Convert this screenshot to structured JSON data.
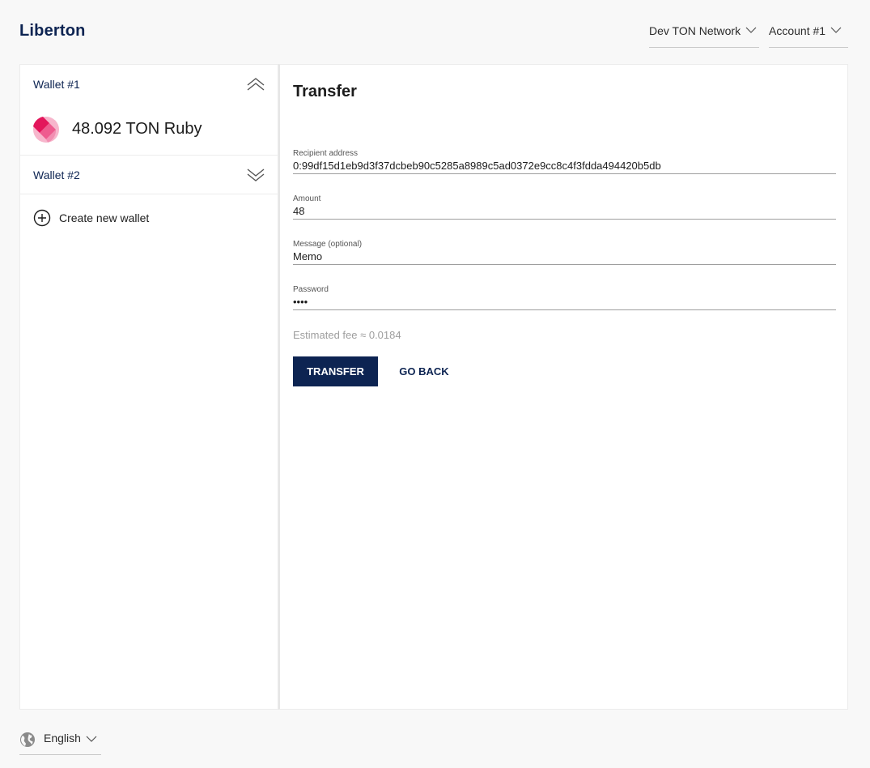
{
  "app": {
    "title": "Liberton"
  },
  "header": {
    "network": "Dev TON Network",
    "account": "Account #1"
  },
  "sidebar": {
    "wallets": [
      {
        "name": "Wallet #1",
        "expanded": true,
        "balance": "48.092 TON Ruby"
      },
      {
        "name": "Wallet #2",
        "expanded": false
      }
    ],
    "create_label": "Create new wallet"
  },
  "transfer": {
    "title": "Transfer",
    "recipient": {
      "label": "Recipient address",
      "value": "0:99df15d1eb9d3f37dcbeb90c5285a8989c5ad0372e9cc8c4f3fdda494420b5db"
    },
    "amount": {
      "label": "Amount",
      "value": "48"
    },
    "message": {
      "label": "Message (optional)",
      "value": "Memo"
    },
    "password": {
      "label": "Password",
      "value": "1234"
    },
    "fee": "Estimated fee ≈ 0.0184",
    "submit_label": "TRANSFER",
    "back_label": "GO BACK"
  },
  "footer": {
    "language": "English"
  },
  "colors": {
    "brand": "#0d2452",
    "ruby": "#e3165b"
  },
  "icons": {
    "network_dropdown": "chevron-down-icon",
    "wallet_collapse": "double-chevron-up-icon",
    "wallet_expand": "double-chevron-down-icon",
    "create": "plus-circle-icon",
    "language": "globe-icon"
  }
}
